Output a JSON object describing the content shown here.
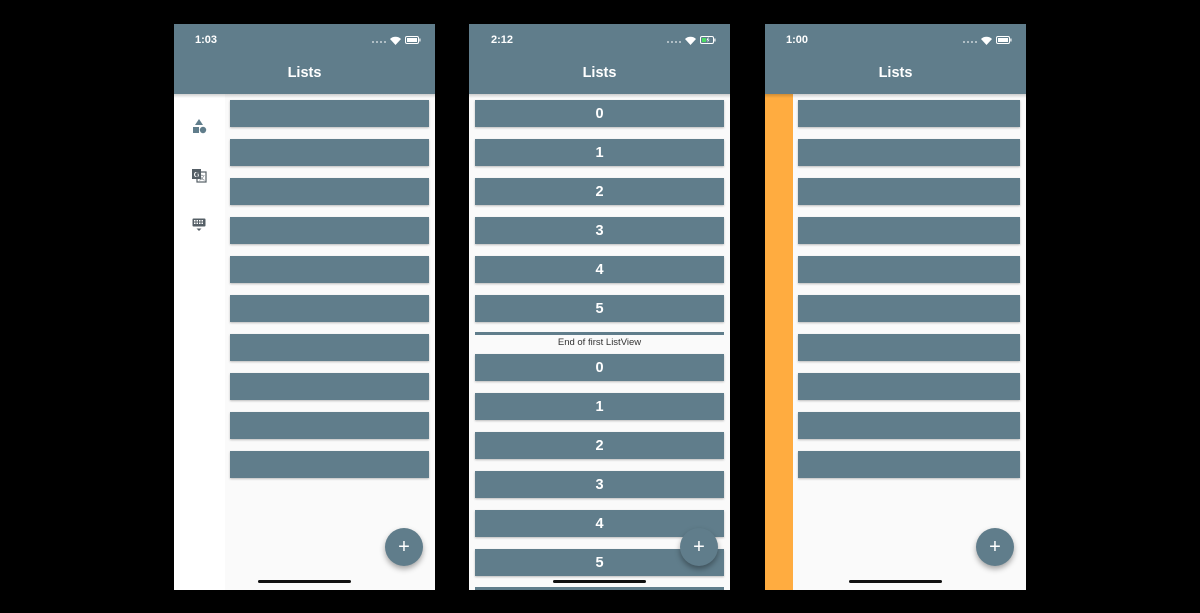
{
  "colors": {
    "appbar": "#607d8b",
    "row": "#607d8b",
    "background": "#fafafa",
    "stripe": "#ffac40",
    "battery_charge": "#4cd964"
  },
  "phones": [
    {
      "time": "1:03",
      "title": "Lists",
      "rail_icons": [
        "shapes-icon",
        "translate-icon",
        "keyboard-hide-icon"
      ],
      "fab_label": "+"
    },
    {
      "time": "2:12",
      "title": "Lists",
      "first_list": [
        "0",
        "1",
        "2",
        "3",
        "4",
        "5"
      ],
      "separator": "End of first ListView",
      "second_list": [
        "0",
        "1",
        "2",
        "3",
        "4",
        "5"
      ],
      "fab_label": "+"
    },
    {
      "time": "1:00",
      "title": "Lists",
      "fab_label": "+"
    }
  ]
}
